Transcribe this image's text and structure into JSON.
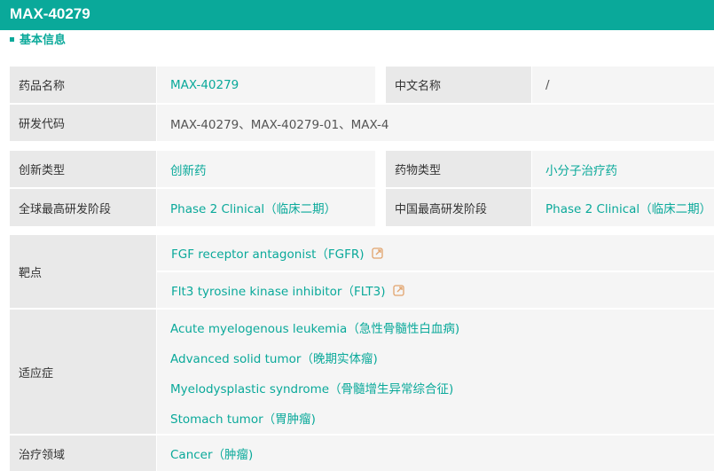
{
  "header": {
    "title": "MAX-40279"
  },
  "section": {
    "title": "基本信息"
  },
  "colors": {
    "accent": "#0aa99a",
    "label_bg": "#e9e9e9",
    "value_bg": "#f5f5f5",
    "icon": "#e2a36c"
  },
  "fields": {
    "drug_name": {
      "label": "药品名称",
      "value": "MAX-40279"
    },
    "chinese_name": {
      "label": "中文名称",
      "value": "/"
    },
    "rd_code": {
      "label": "研发代码",
      "value": "MAX-40279、MAX-40279-01、MAX-4"
    },
    "innovation_type": {
      "label": "创新类型",
      "value": "创新药"
    },
    "drug_type": {
      "label": "药物类型",
      "value": "小分子治疗药"
    },
    "global_phase": {
      "label": "全球最高研发阶段",
      "value": "Phase 2 Clinical（临床二期）"
    },
    "china_phase": {
      "label": "中国最高研发阶段",
      "value": "Phase 2 Clinical（临床二期）"
    },
    "target": {
      "label": "靶点",
      "items": [
        {
          "text": "FGF receptor antagonist（FGFR)",
          "icon": "external-link-icon"
        },
        {
          "text": "Flt3 tyrosine kinase inhibitor（FLT3)",
          "icon": "external-link-icon"
        }
      ]
    },
    "indication": {
      "label": "适应症",
      "items": [
        "Acute myelogenous leukemia（急性骨髓性白血病)",
        "Advanced solid tumor（晚期实体瘤)",
        "Myelodysplastic syndrome（骨髓增生异常综合征)",
        "Stomach tumor（胃肿瘤)"
      ]
    },
    "therapeutic_area": {
      "label": "治疗领域",
      "value": "Cancer（肿瘤)"
    }
  }
}
